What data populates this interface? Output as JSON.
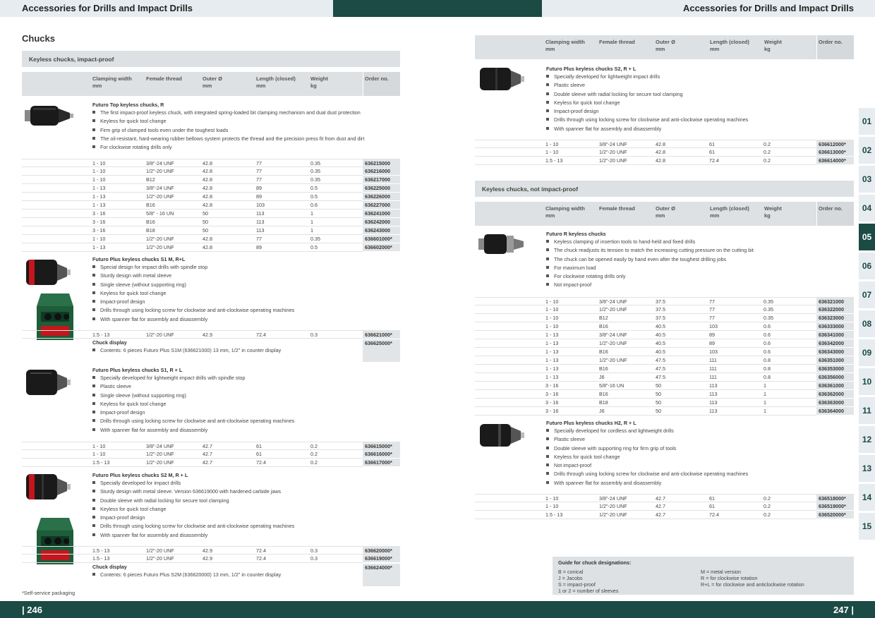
{
  "header": {
    "title_left": "Accessories for Drills and Impact Drills",
    "title_right": "Accessories for Drills and Impact Drills"
  },
  "footer": {
    "page_left": "| 246",
    "page_right": "247 |"
  },
  "section_title": "Chucks",
  "columns": [
    "Clamping width\nmm",
    "Female thread",
    "Outer Ø\nmm",
    "Length (closed)\nmm",
    "Weight\nkg",
    "Order no."
  ],
  "left": {
    "bar1": "Keyless chucks, impact-proof",
    "p1": {
      "name": "Futuro Top keyless chucks, R",
      "bullets": [
        "The first impact-proof keyless chuck, with integrated spring-loaded bit clamping mechanism and dual dust protection",
        "Keyless for quick tool change",
        "Firm grip of clamped tools even under the toughest loads",
        "The oil-resistant, hard-wearing rubber bellows system protects the thread and the precision press fit from dust and dirt",
        "For clockwise rotating drills only"
      ],
      "rows": [
        [
          "1 - 10",
          "3/8\"-24 UNF",
          "42.8",
          "77",
          "0.35",
          "636215000"
        ],
        [
          "1 - 10",
          "1/2\"-20 UNF",
          "42.8",
          "77",
          "0.35",
          "636216000"
        ],
        [
          "1 - 10",
          "B12",
          "42.8",
          "77",
          "0.35",
          "636217000"
        ],
        [
          "1 - 13",
          "3/8\"-24 UNF",
          "42.8",
          "89",
          "0.5",
          "636225000"
        ],
        [
          "1 - 13",
          "1/2\"-20 UNF",
          "42.8",
          "89",
          "0.5",
          "636226000"
        ],
        [
          "1 - 13",
          "B16",
          "42.8",
          "103",
          "0.6",
          "636227000"
        ],
        [
          "3 - 16",
          "5/8\" - 16 UN",
          "50",
          "113",
          "1",
          "636241000"
        ],
        [
          "3 - 16",
          "B16",
          "50",
          "113",
          "1",
          "636242000"
        ],
        [
          "3 - 16",
          "B18",
          "50",
          "113",
          "1",
          "636243000"
        ],
        [
          "1 - 10",
          "1/2\"-20 UNF",
          "42.8",
          "77",
          "0.35",
          "636601000*"
        ],
        [
          "1 - 13",
          "1/2\"-20 UNF",
          "42.8",
          "89",
          "0.5",
          "636602000*"
        ]
      ]
    },
    "p2": {
      "name": "Futuro Plus keyless chucks S1 M, R+L",
      "bullets": [
        "Special design for impact drills with spindle stop",
        "Sturdy design with metal sleeve",
        "Single sleeve (without supporting ring)",
        "Keyless for quick tool change",
        "Impact-proof design",
        "Drills through using locking screw for clockwise and anti-clockwise operating machines",
        "With spanner flat for assembly and disassembly"
      ],
      "rows": [
        [
          "1.5 - 13",
          "1/2\"-20 UNF",
          "42.9",
          "72.4",
          "0.3",
          "636621000*"
        ]
      ],
      "display_title": "Chuck display",
      "display_text": "Contents: 6 pieces Futuro Plus S1M (636621000) 13 mm, 1/2\" in counter display",
      "display_order": "636625000*"
    },
    "p3": {
      "name": "Futuro Plus keyless chucks S1, R + L",
      "bullets": [
        "Specially developed for lightweight impact drills with spindle stop",
        "Plastic sleeve",
        "Single sleeve (without supporting ring)",
        "Keyless for quick tool change",
        "Impact-proof design",
        "Drills through using locking screw for clockwise and anti-clockwise operating machines",
        "With spanner flat for assembly and disassembly"
      ],
      "rows": [
        [
          "1 - 10",
          "3/8\"-24 UNF",
          "42.7",
          "61",
          "0.2",
          "636615000*"
        ],
        [
          "1 - 10",
          "1/2\"-20 UNF",
          "42.7",
          "61",
          "0.2",
          "636616000*"
        ],
        [
          "1.5 - 13",
          "1/2\"-20 UNF",
          "42.7",
          "72.4",
          "0.2",
          "636617000*"
        ]
      ]
    },
    "p4": {
      "name": "Futuro Plus keyless chucks S2 M, R + L",
      "bullets": [
        "Specially developed for impact drills",
        "Sturdy design with metal sleeve. Version 636619000 with hardened carbide jaws",
        "Double sleeve with radial locking for secure tool clamping",
        "Keyless for quick tool change",
        "Impact-proof design",
        "Drills through using locking screw for clockwise and anti-clockwise operating machines",
        "With spanner flat for assembly and disassembly"
      ],
      "rows": [
        [
          "1.5 - 13",
          "1/2\"-20 UNF",
          "42.9",
          "72.4",
          "0.3",
          "636620000*"
        ],
        [
          "1.5 - 13",
          "1/2\"-20 UNF",
          "42.9",
          "72.4",
          "0.3",
          "636619000*"
        ]
      ],
      "display_title": "Chuck display",
      "display_text": "Contents: 6 pieces Futuro Plus S2M (636620000) 13 mm, 1/2\" in counter display",
      "display_order": "636624000*"
    },
    "footnote": "*Self-service packaging"
  },
  "right": {
    "p1": {
      "name": "Futuro Plus keyless chucks S2, R + L",
      "bullets": [
        "Specially developed for lightweight impact drills",
        "Plastic sleeve",
        "Double sleeve with radial locking for secure tool clamping",
        "Keyless for quick tool change",
        "Impact-proof design",
        "Drills through using locking screw for clockwise and anti-clockwise operating machines",
        "With spanner flat for assembly and disassembly"
      ],
      "rows": [
        [
          "1 - 10",
          "3/8\"-24 UNF",
          "42.8",
          "61",
          "0.2",
          "636612000*"
        ],
        [
          "1 - 10",
          "1/2\"-20 UNF",
          "42.8",
          "61",
          "0.2",
          "636613000*"
        ],
        [
          "1.5 - 13",
          "1/2\"-20 UNF",
          "42.8",
          "72.4",
          "0.2",
          "636614000*"
        ]
      ]
    },
    "bar2": "Keyless chucks, not impact-proof",
    "p2": {
      "name": "Futuro R keyless chucks",
      "bullets": [
        "Keyless clamping of insertion tools to hand-held and fixed drills",
        "The chuck readjusts its tension to match the increasing cutting pressure on the cutting bit",
        "The chuck can be opened easily by hand even after the toughest drilling jobs",
        "For maximum load",
        "For clockwise rotating drills only",
        "Not impact-proof"
      ],
      "rows": [
        [
          "1 - 10",
          "3/8\"-24 UNF",
          "37.5",
          "77",
          "0.35",
          "636321000"
        ],
        [
          "1 - 10",
          "1/2\"-20 UNF",
          "37.5",
          "77",
          "0.35",
          "636322000"
        ],
        [
          "1 - 10",
          "B12",
          "37.5",
          "77",
          "0.35",
          "636323000"
        ],
        [
          "1 - 10",
          "B16",
          "40.5",
          "103",
          "0.6",
          "636333000"
        ],
        [
          "1 - 13",
          "3/8\"-24 UNF",
          "40.5",
          "89",
          "0.6",
          "636341000"
        ],
        [
          "1 - 13",
          "1/2\"-20 UNF",
          "40.5",
          "89",
          "0.6",
          "636342000"
        ],
        [
          "1 - 13",
          "B16",
          "40.5",
          "103",
          "0.6",
          "636343000"
        ],
        [
          "1 - 13",
          "1/2\"-20 UNF",
          "47.5",
          "111",
          "0.8",
          "636351000"
        ],
        [
          "1 - 13",
          "B16",
          "47.5",
          "111",
          "0.8",
          "636353000"
        ],
        [
          "1 - 13",
          "J6",
          "47.5",
          "111",
          "0.8",
          "636356000"
        ],
        [
          "3 - 16",
          "5/8\"-16 UN",
          "50",
          "113",
          "1",
          "636361000"
        ],
        [
          "3 - 16",
          "B16",
          "50",
          "113",
          "1",
          "636362000"
        ],
        [
          "3 - 16",
          "B18",
          "50",
          "113",
          "1",
          "636363000"
        ],
        [
          "3 - 16",
          "J6",
          "50",
          "113",
          "1",
          "636364000"
        ]
      ]
    },
    "p3": {
      "name": "Futuro Plus keyless chucks H2, R + L",
      "bullets": [
        "Specially developed for cordless and lightweight drills",
        "Plastic sleeve",
        "Double sleeve with supporting ring for firm grip of tools",
        "Keyless for quick tool change",
        "Not impact-proof",
        "Drills through using locking screw for clockwise and anti-clockwise operating machines",
        "With spanner flat for assembly and disassembly"
      ],
      "rows": [
        [
          "1 - 10",
          "3/8\"-24 UNF",
          "42.7",
          "61",
          "0.2",
          "636518000*"
        ],
        [
          "1 - 10",
          "1/2\"-20 UNF",
          "42.7",
          "61",
          "0.2",
          "636519000*"
        ],
        [
          "1.5 - 13",
          "1/2\"-20 UNF",
          "42.7",
          "72.4",
          "0.2",
          "636520000*"
        ]
      ]
    },
    "guide": {
      "title": "Guide for chuck designations:",
      "left": [
        "B = conical",
        "J = Jacobs",
        "S = impact-proof",
        "1 or 2 = number of sleeves"
      ],
      "right": [
        "M = metal version",
        "R = for clockwise rotation",
        "R+L = for clockwise and anticlockwise rotation"
      ]
    }
  },
  "tabs": [
    "01",
    "02",
    "03",
    "04",
    "05",
    "06",
    "07",
    "08",
    "09",
    "10",
    "11",
    "12",
    "13",
    "14",
    "15"
  ],
  "active_tab": "05",
  "colors": {
    "accent": "#1c4a45",
    "header_bg": "#e6ecef",
    "bar_bg": "#dde1e3"
  }
}
